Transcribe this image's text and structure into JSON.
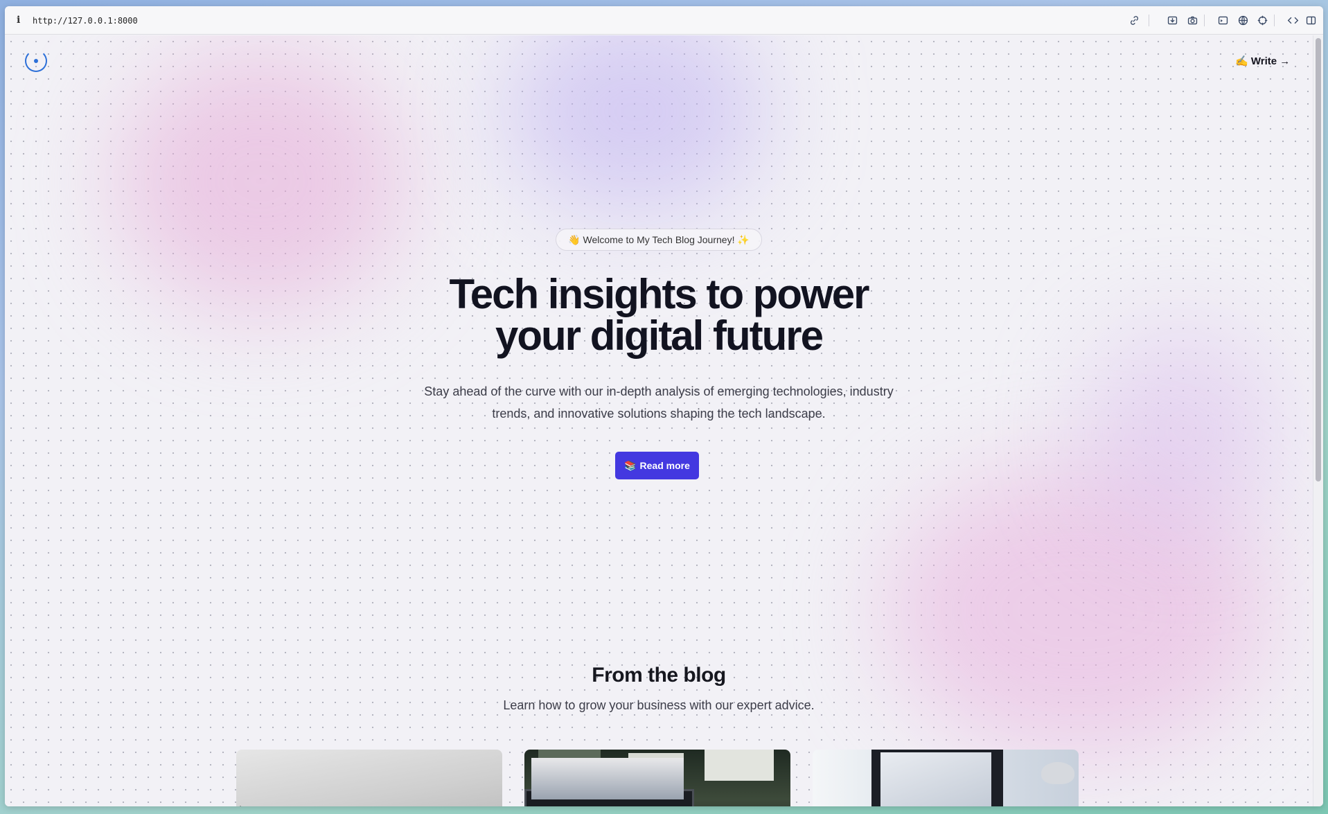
{
  "browser": {
    "url": "http://127.0.0.1:8000",
    "info_icon": "i",
    "toolbar_icons": [
      "link-icon",
      "download-icon",
      "camera-icon",
      "terminal-icon",
      "globe-icon",
      "crosshair-icon",
      "code-icon",
      "split-view-icon"
    ]
  },
  "nav": {
    "logo_icon": "logo-icon",
    "write_link": "✍️ Write →"
  },
  "hero": {
    "badge": "👋 Welcome to My Tech Blog Journey! ✨",
    "headline_line1": "Tech insights to power",
    "headline_line2": "your digital future",
    "subtext": "Stay ahead of the curve with our in-depth analysis of emerging technologies, industry trends, and innovative solutions shaping the tech landscape.",
    "cta_emoji": "📚",
    "cta_label": "Read more",
    "cta_color": "#4338e0"
  },
  "blog": {
    "title": "From the blog",
    "subtitle": "Learn how to grow your business with our expert advice."
  }
}
